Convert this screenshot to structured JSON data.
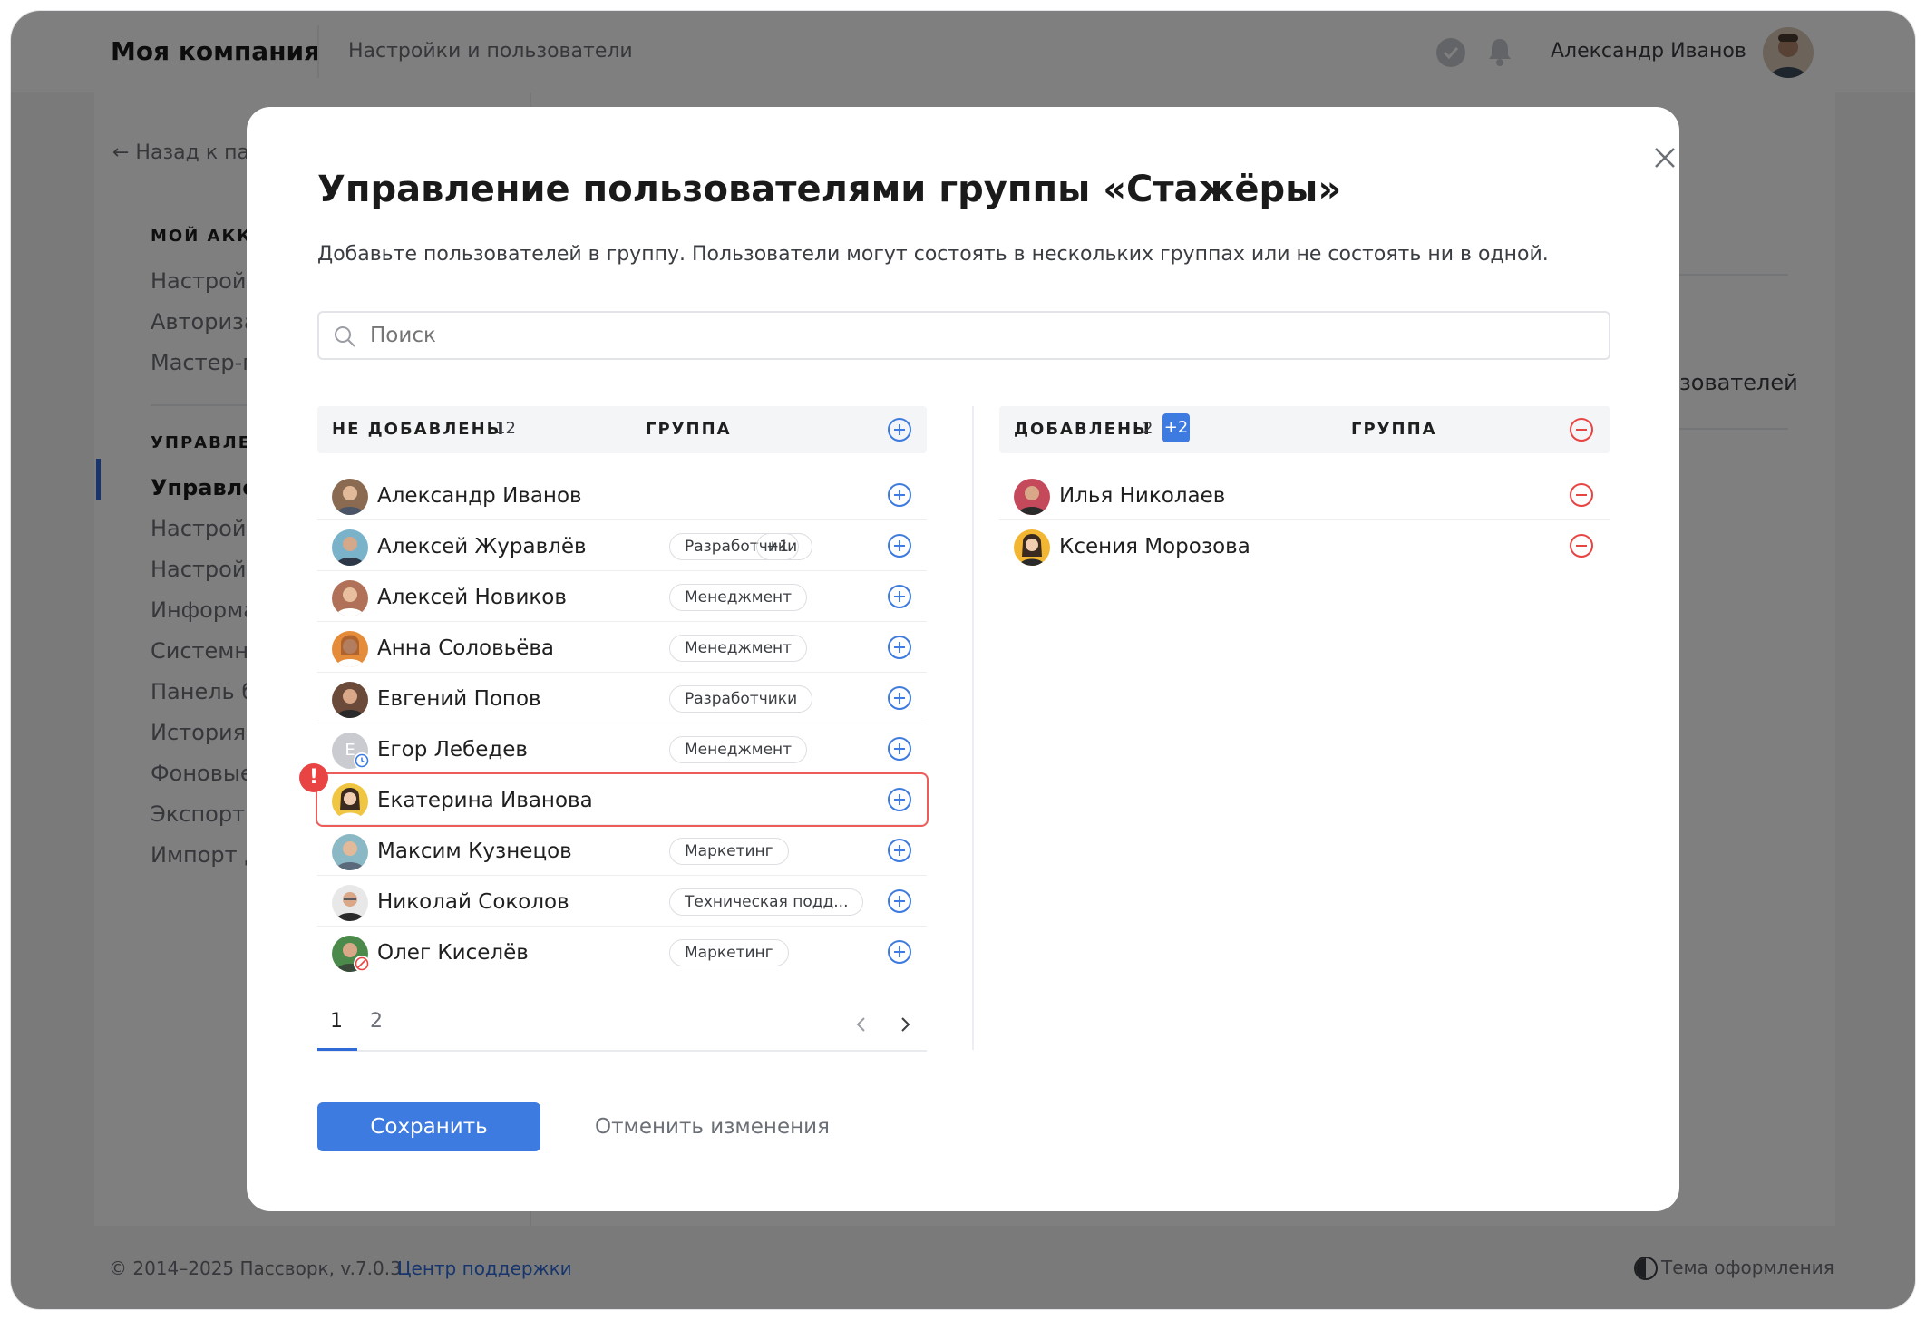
{
  "app": {
    "company": "Моя компания",
    "crumb": "Настройки и пользователи",
    "user": "Александр Иванов"
  },
  "sidebar": {
    "back": "← Назад к па",
    "section1": "МОЙ АККА",
    "items1": [
      "Настройк",
      "Авториза",
      "Мастер-п"
    ],
    "section2": "УПРАВЛЕН",
    "items2": [
      "Управлен",
      "Настройк",
      "Настройк",
      "Информа",
      "Системн",
      "Панель бе",
      "История д",
      "Фоновые",
      "Экспорт д",
      "Импорт д"
    ]
  },
  "background": {
    "right_text": "зователей"
  },
  "footer": {
    "copyright": "© 2014–2025 Пассворк, v.7.0.3",
    "support": "Центр поддержки",
    "theme": "Тема оформления"
  },
  "modal": {
    "title": "Управление пользователями группы «Стажёры»",
    "description": "Добавьте пользователей в группу. Пользователи могут состоять в нескольких группах или не состоять ни в одной.",
    "search_placeholder": "Поиск",
    "left": {
      "label": "НЕ ДОБАВЛЕНЫ",
      "count": "12",
      "group_header": "ГРУППА",
      "rows": [
        {
          "name": "Александр Иванов",
          "group": "",
          "avatar_color": "#8b6a52"
        },
        {
          "name": "Алексей Журавлёв",
          "group": "Разработчики",
          "extra": "+1",
          "avatar_color": "#7ab3c9"
        },
        {
          "name": "Алексей Новиков",
          "group": "Менеджмент",
          "avatar_color": "#b07158"
        },
        {
          "name": "Анна Соловьёва",
          "group": "Менеджмент",
          "avatar_color": "#e58c3b"
        },
        {
          "name": "Евгений Попов",
          "group": "Разработчики",
          "avatar_color": "#6b4a3a"
        },
        {
          "name": "Егор Лебедев",
          "group": "Менеджмент",
          "avatar_letter": "Е",
          "avatar_color": "#c9cbd0"
        },
        {
          "name": "Екатерина Иванова",
          "group": "",
          "avatar_color": "#f0c542",
          "warning": "!"
        },
        {
          "name": "Максим Кузнецов",
          "group": "Маркетинг",
          "avatar_color": "#8bb8c5"
        },
        {
          "name": "Николай Соколов",
          "group": "Техническая подд...",
          "avatar_color": "#5a5a5a"
        },
        {
          "name": "Олег Киселёв",
          "group": "Маркетинг",
          "avatar_color": "#4c8a4c"
        }
      ],
      "pages": [
        "1",
        "2"
      ]
    },
    "right": {
      "label": "ДОБАВЛЕНЫ",
      "count": "2",
      "badge": "+2",
      "group_header": "ГРУППА",
      "rows": [
        {
          "name": "Илья Николаев",
          "avatar_color": "#c4495a"
        },
        {
          "name": "Ксения Морозова",
          "avatar_color": "#f2b632"
        }
      ]
    },
    "save": "Сохранить",
    "cancel": "Отменить изменения"
  },
  "colors": {
    "accent": "#3e7be0",
    "danger": "#e94444"
  }
}
